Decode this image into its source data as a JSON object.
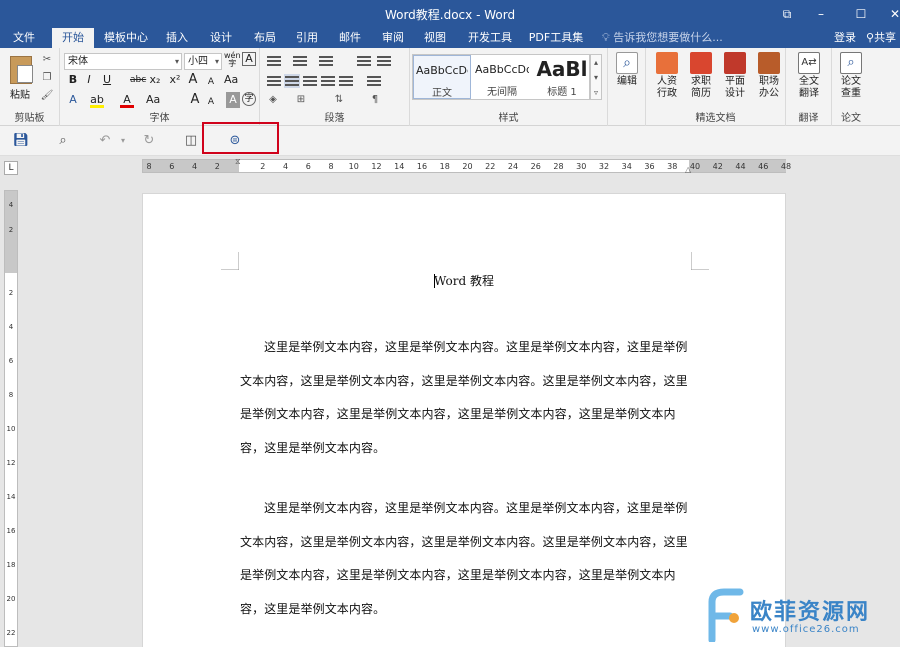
{
  "window": {
    "title": "Word教程.docx - Word",
    "controls": {
      "ribbon_display": "⧉",
      "minimize": "–",
      "maximize": "☐",
      "close": "✕"
    }
  },
  "menu": {
    "tabs": [
      {
        "label": "文件"
      },
      {
        "label": "开始",
        "active": true
      },
      {
        "label": "模板中心"
      },
      {
        "label": "插入"
      },
      {
        "label": "设计"
      },
      {
        "label": "布局"
      },
      {
        "label": "引用"
      },
      {
        "label": "邮件"
      },
      {
        "label": "审阅"
      },
      {
        "label": "视图"
      },
      {
        "label": "开发工具"
      },
      {
        "label": "PDF工具集"
      }
    ],
    "tellme": "告诉我您想要做什么...",
    "login": "登录",
    "share": "共享"
  },
  "ribbon": {
    "clipboard": {
      "paste": "粘贴",
      "label": "剪贴板"
    },
    "font": {
      "name": "宋体",
      "size": "小四",
      "wen": "wén",
      "buttons": {
        "bold": "B",
        "italic": "I",
        "underline": "U",
        "strike": "abc",
        "sub": "x₂",
        "sup": "x²",
        "color": "A",
        "case": "Aa",
        "grow": "A",
        "shrink": "A",
        "clear": "A",
        "char_border": "A",
        "enclose": "字"
      },
      "label": "字体"
    },
    "paragraph": {
      "label": "段落"
    },
    "styles": {
      "items": [
        {
          "sample": "AaBbCcDd",
          "name": "正文"
        },
        {
          "sample": "AaBbCcDd",
          "name": "无间隔"
        },
        {
          "sample": "AaBl",
          "name": "标题 1"
        }
      ],
      "label": "样式"
    },
    "editing": {
      "label": "编辑"
    },
    "jingxuan": {
      "buttons": [
        {
          "label": "人资\n行政"
        },
        {
          "label": "求职\n简历"
        },
        {
          "label": "平面\n设计"
        },
        {
          "label": "职场\n办公"
        }
      ],
      "label": "精选文档"
    },
    "translate": {
      "button": "全文\n翻译",
      "label": "翻译"
    },
    "paper": {
      "button": "论文\n查重",
      "label": "论文"
    }
  },
  "ruler": {
    "corner": "L",
    "h_ticks": [
      "8",
      "6",
      "4",
      "2",
      "2",
      "4",
      "6",
      "8",
      "10",
      "12",
      "14",
      "16",
      "18",
      "20",
      "22",
      "24",
      "26",
      "28",
      "30",
      "32",
      "34",
      "36",
      "38",
      "40",
      "42",
      "44",
      "46",
      "48"
    ],
    "v_ticks": [
      "4",
      "2",
      "2",
      "4",
      "6",
      "8",
      "10",
      "12",
      "14",
      "16",
      "18",
      "20",
      "22"
    ]
  },
  "document": {
    "title": "Word 教程",
    "paragraphs": [
      "这里是举例文本内容，这里是举例文本内容。这里是举例文本内容，这里是举例文本内容，这里是举例文本内容，这里是举例文本内容。这里是举例文本内容，这里是举例文本内容，这里是举例文本内容，这里是举例文本内容，这里是举例文本内容，这里是举例文本内容。",
      "这里是举例文本内容，这里是举例文本内容。这里是举例文本内容，这里是举例文本内容，这里是举例文本内容，这里是举例文本内容。这里是举例文本内容，这里是举例文本内容，这里是举例文本内容，这里是举例文本内容，这里是举例文本内容，这里是举例文本内容。"
    ]
  },
  "watermark": {
    "name": "欧菲资源网",
    "url": "www.office26.com"
  }
}
